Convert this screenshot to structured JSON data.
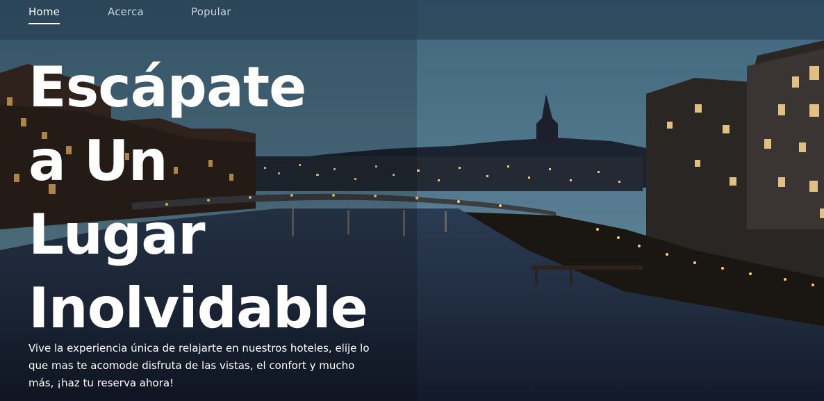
{
  "nav": {
    "items": [
      {
        "label": "Home",
        "active": true
      },
      {
        "label": "Acerca",
        "active": false
      },
      {
        "label": "Popular",
        "active": false
      }
    ]
  },
  "hero": {
    "headline_lines": [
      "Escápate",
      "a Un",
      "Lugar",
      "Inolvidable"
    ],
    "description": "Vive la experiencia única de relajarte en nuestros hoteles, elije lo que mas te acomode disfruta de las vistas, el confort y mucho más, ¡haz tu reserva ahora!"
  },
  "colors": {
    "nav_bg": "#284054",
    "text": "#ffffff",
    "sky_top": "#3f6277",
    "water": "#1f2d3f"
  }
}
